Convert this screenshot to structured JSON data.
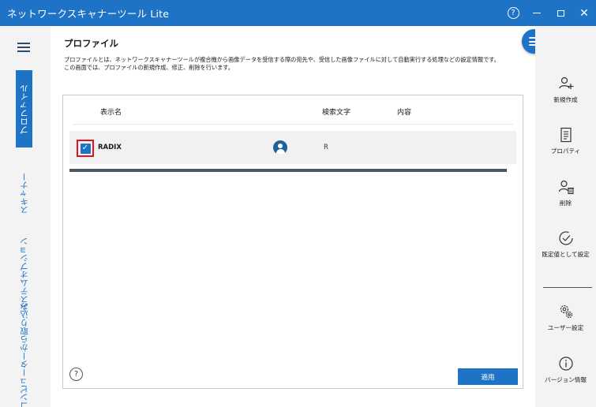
{
  "window": {
    "title": "ネットワークスキャナーツール Lite",
    "help_glyph": "?",
    "close_glyph": "✕"
  },
  "nav": {
    "items": [
      {
        "label": "プロファイル",
        "active": true
      },
      {
        "label": "スキャナー",
        "active": false
      },
      {
        "label": "システムオプション",
        "active": false
      },
      {
        "label": "コンピューターから取り込み",
        "active": false
      }
    ]
  },
  "page": {
    "title": "プロファイル",
    "description_1": "プロファイルとは、ネットワークスキャナーツールが複合機から画像データを受信する際の宛先や、受信した画像ファイルに対して自動実行する処理などの設定情報です。",
    "description_2": "この画面では、プロファイルの新規作成、修正、削除を行います。"
  },
  "table": {
    "columns": {
      "name": "表示名",
      "search": "検索文字",
      "content": "内容"
    },
    "rows": [
      {
        "name": "RADIX",
        "search": "R",
        "content": "",
        "checked": true,
        "check_glyph": "✓"
      }
    ]
  },
  "footer": {
    "help_glyph": "?",
    "apply_label": "適用"
  },
  "actions": {
    "new": "新規作成",
    "properties": "プロパティ",
    "delete": "削除",
    "set_default": "既定値として設定",
    "user_settings": "ユーザー設定",
    "version": "バージョン情報"
  },
  "colors": {
    "accent": "#1f73c6",
    "highlight_border": "#e0141e",
    "scrollbar": "#4a5864"
  },
  "icons": {
    "menu": "hamburger-icon",
    "fab": "menu-lines-icon",
    "new": "add-user-icon",
    "properties": "document-icon",
    "delete": "delete-user-icon",
    "set_default": "checkmark-circle-icon",
    "user_settings": "gears-icon",
    "version": "info-icon"
  }
}
